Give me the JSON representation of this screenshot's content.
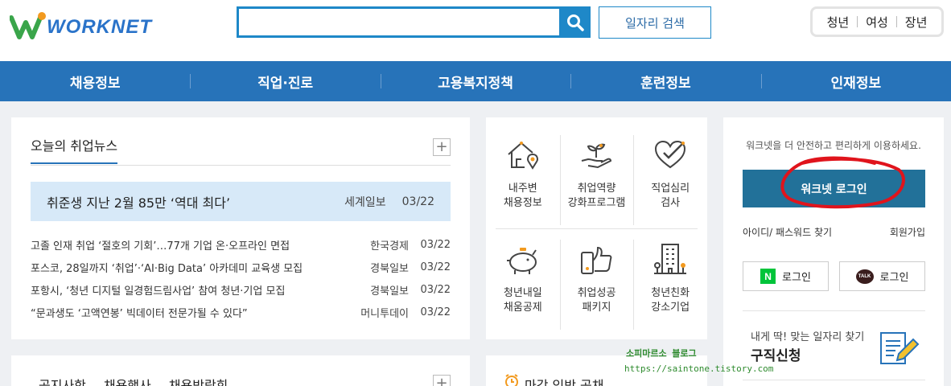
{
  "header": {
    "logo_text": "WORKNET",
    "search": {
      "value": "",
      "placeholder": ""
    },
    "job_search_label": "일자리 검색",
    "user_types": [
      "청년",
      "여성",
      "장년"
    ]
  },
  "nav": [
    "채용정보",
    "직업·진로",
    "고용복지정책",
    "훈련정보",
    "인재정보"
  ],
  "news": {
    "tab_label": "오늘의 취업뉴스",
    "plus": "+",
    "headline": {
      "title": "취준생 지난 2월 85만 ‘역대 최다’",
      "source": "세계일보",
      "date": "03/22"
    },
    "items": [
      {
        "title": "고졸 인재 취업 ‘절호의 기회’…77개 기업 온·오프라인 면접",
        "source": "한국경제",
        "date": "03/22"
      },
      {
        "title": "포스코, 28일까지 ‘취업’·‘AI·Big Data’ 아카데미 교육생 모집",
        "source": "경북일보",
        "date": "03/22"
      },
      {
        "title": "포항시, ‘청년 디지털 일경험드림사업’ 참여 청년·기업 모집",
        "source": "경북일보",
        "date": "03/22"
      },
      {
        "title": "“문과생도 ‘고액연봉’ 빅데이터 전문가될 수 있다”",
        "source": "머니투데이",
        "date": "03/22"
      }
    ]
  },
  "notice": {
    "tabs": [
      "공지사항",
      "채용행사",
      "채용박람회"
    ],
    "plus": "+"
  },
  "services": [
    {
      "label": "내주변\n채용정보",
      "icon": "house-location-icon"
    },
    {
      "label": "취업역량\n강화프로그램",
      "icon": "sprout-hand-icon"
    },
    {
      "label": "직업심리\n검사",
      "icon": "heart-check-icon"
    },
    {
      "label": "청년내일\n채움공제",
      "icon": "piggy-bank-icon"
    },
    {
      "label": "취업성공\n패키지",
      "icon": "thumbs-up-phone-icon"
    },
    {
      "label": "청년친화\n강소기업",
      "icon": "building-icon"
    }
  ],
  "deadline": {
    "title": "마감 임박 공채"
  },
  "login": {
    "message": "워크넷을 더 안전하고 편리하게 이용하세요.",
    "button_label": "워크넷 로그인",
    "find_label": "아이디/ 패스워드 찾기",
    "signup_label": "회원가입",
    "naver_mark": "N",
    "naver_label": "로그인",
    "kakao_mark": "TALK",
    "kakao_label": "로그인",
    "apply_sub": "내게 딱! 맞는 일자리 찾기",
    "apply_main": "구직신청"
  },
  "watermark": {
    "line1": "소피마르소 블로그",
    "line2": "https://saintone.tistory.com"
  },
  "colors": {
    "primary": "#2773b9",
    "search_accent": "#1e88c8",
    "login_button": "#227199",
    "headline_bg": "#d7e9f8",
    "annotation_red": "#e0141c"
  }
}
